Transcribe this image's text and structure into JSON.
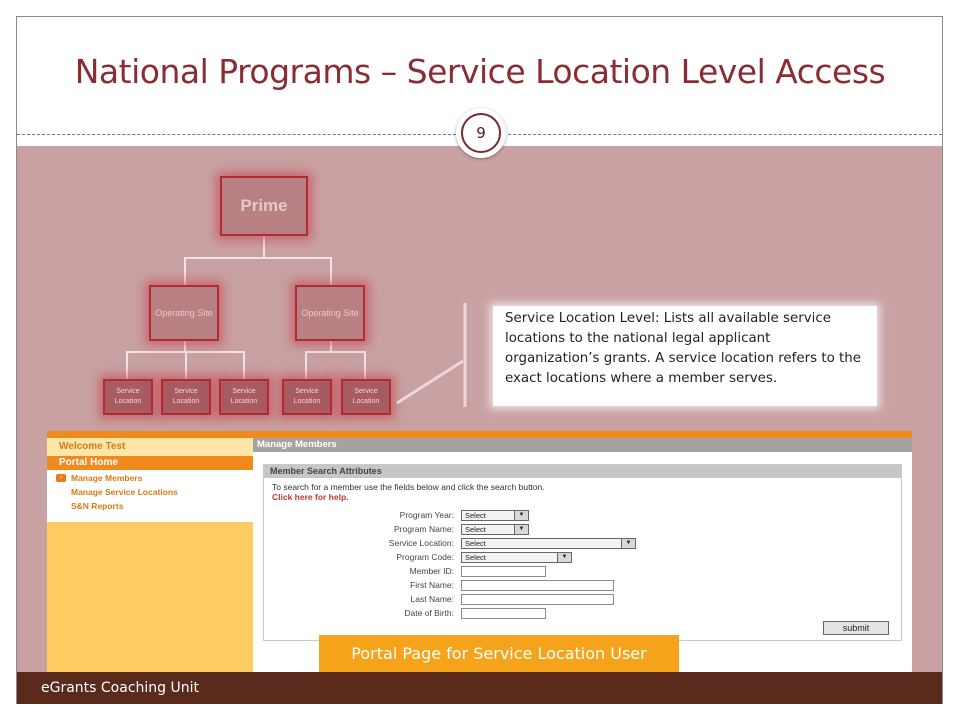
{
  "slide": {
    "title": "National Programs – Service Location Level Access",
    "page_number": "9",
    "footer": "eGrants Coaching Unit",
    "caption": "Portal Page for Service Location User",
    "accent_color": "#8b2c33",
    "band_color": "#c9a1a3"
  },
  "hierarchy": {
    "prime": "Prime",
    "operating_site": "Operating Site",
    "service_location": "Service Location",
    "description": "Service Location Level:  Lists all available service locations to the national legal applicant organization’s grants.  A service location refers to the exact locations  where a member serves."
  },
  "portal": {
    "welcome": "Welcome Test",
    "portal_home": "Portal Home",
    "nav": [
      "Manage Members",
      "Manage Service Locations",
      "S&N Reports"
    ],
    "page_header": "Manage Members",
    "search": {
      "header": "Member Search Attributes",
      "instructions": "To search for a member use the fields below and click the search button.",
      "help_link": "Click here for help.",
      "fields": {
        "program_year": {
          "label": "Program Year:",
          "value": "Select"
        },
        "program_name": {
          "label": "Program Name:",
          "value": "Select"
        },
        "service_location": {
          "label": "Service Location:",
          "value": "Select"
        },
        "program_code": {
          "label": "Program Code:",
          "value": "Select"
        },
        "member_id": {
          "label": "Member ID:",
          "value": ""
        },
        "first_name": {
          "label": "First Name:",
          "value": ""
        },
        "last_name": {
          "label": "Last Name:",
          "value": ""
        },
        "date_of_birth": {
          "label": "Date of Birth:",
          "value": ""
        }
      },
      "submit": "submit"
    }
  }
}
